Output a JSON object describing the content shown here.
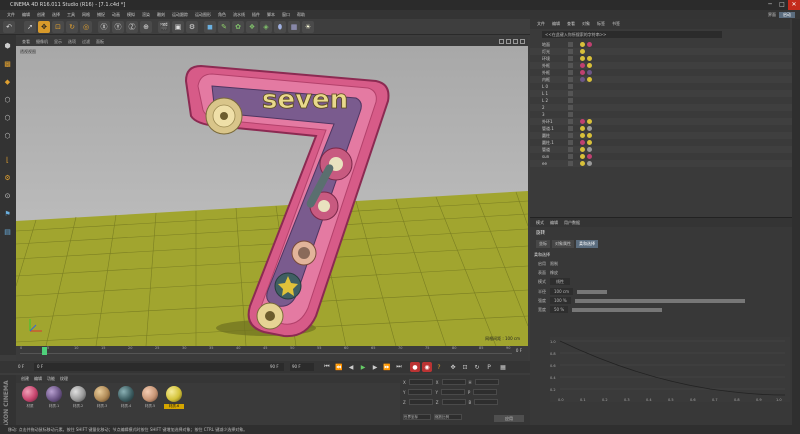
{
  "window": {
    "title": "CINEMA 4D R16.011 Studio (R16) - [7.1.c4d *]",
    "min": "─",
    "max": "□",
    "close": "✕"
  },
  "menu": [
    "文件",
    "编辑",
    "创建",
    "选择",
    "工具",
    "网格",
    "捕捉",
    "动画",
    "模拟",
    "渲染",
    "雕刻",
    "运动跟踪",
    "运动图形",
    "角色",
    "流水线",
    "插件",
    "脚本",
    "窗口",
    "帮助"
  ],
  "layout": {
    "label": "界面",
    "value": "启动"
  },
  "viewport": {
    "menu": [
      "查看",
      "摄像机",
      "显示",
      "选项",
      "过滤",
      "面板"
    ],
    "label": "透视视图",
    "grid_label": "网格间距 : 100 cm",
    "logo_text": "seven"
  },
  "timeline": {
    "ticks": [
      "0",
      "5",
      "10",
      "15",
      "20",
      "25",
      "30",
      "35",
      "40",
      "45",
      "50",
      "55",
      "60",
      "65",
      "70",
      "75",
      "80",
      "85",
      "90"
    ],
    "frame_end_label": "0 F",
    "current": "0 F",
    "start": "0 F",
    "end": "90 F",
    "end2": "90 F"
  },
  "materials": {
    "menu": [
      "创建",
      "编辑",
      "功能",
      "纹理"
    ],
    "items": [
      {
        "name": "材质",
        "color": "#c8466f"
      },
      {
        "name": "材质.1",
        "color": "#6c5687"
      },
      {
        "name": "材质.2",
        "color": "#9a9a9a"
      },
      {
        "name": "材质.3",
        "color": "#b08a57"
      },
      {
        "name": "材质.4",
        "color": "#3e5f63"
      },
      {
        "name": "材质.5",
        "color": "#c89676"
      },
      {
        "name": "材质.6",
        "color": "#d4c33a"
      }
    ]
  },
  "coords": {
    "rows": [
      {
        "a": "X",
        "v1": "0 cm",
        "b": "X",
        "v2": "0 cm",
        "c": "H",
        "v3": "0 °"
      },
      {
        "a": "Y",
        "v1": "0 cm",
        "b": "Y",
        "v2": "0 cm",
        "c": "P",
        "v3": "0 °"
      },
      {
        "a": "Z",
        "v1": "0 cm",
        "b": "Z",
        "v2": "0 cm",
        "c": "B",
        "v3": "0 °"
      }
    ],
    "mode1": "世界坐标",
    "mode2": "缩放比例",
    "apply": "应用"
  },
  "status": "移动: 点击并拖动鼠标移动元素。按住 SHIFT 键量化移动；节点编辑模式时按住 SHIFT 键增加选择对象；按住 CTRL 键减少选择对象。",
  "maxon": "MAXON CINEMA 4D",
  "objects": {
    "menu": [
      "文件",
      "编辑",
      "查看",
      "对象",
      "标签",
      "书签"
    ],
    "search": "<<在此键入你所搜索的字符串>>",
    "rows": [
      {
        "name": "地面",
        "tags": [
          "#d8c03a",
          "#c04070"
        ]
      },
      {
        "name": "灯光",
        "tags": [
          "#d8c03a"
        ]
      },
      {
        "name": "环境",
        "tags": [
          "#d8c03a",
          "#d8c03a"
        ]
      },
      {
        "name": "外框",
        "tags": [
          "#c04070",
          "#d8c03a"
        ]
      },
      {
        "name": "外框",
        "tags": [
          "#c04070",
          "#6c5687"
        ]
      },
      {
        "name": "内框",
        "tags": [
          "#6c5687",
          "#d8c03a"
        ]
      },
      {
        "name": "L 0",
        "tags": []
      },
      {
        "name": "L 1",
        "tags": []
      },
      {
        "name": "L 2",
        "tags": []
      },
      {
        "name": "2",
        "tags": []
      },
      {
        "name": "3",
        "tags": []
      },
      {
        "name": "外环1",
        "tags": [
          "#c04070",
          "#d8c03a"
        ]
      },
      {
        "name": "管道.1",
        "tags": [
          "#d8c03a",
          "#9a9a9a"
        ]
      },
      {
        "name": "圆柱",
        "tags": [
          "#d8c03a",
          "#d8c03a"
        ]
      },
      {
        "name": "圆柱.1",
        "tags": [
          "#c04070",
          "#d8c03a"
        ]
      },
      {
        "name": "管道",
        "tags": [
          "#d8c03a",
          "#9a9a9a"
        ]
      },
      {
        "name": "sun",
        "tags": [
          "#d8c03a",
          "#c04070"
        ]
      },
      {
        "name": "ee",
        "tags": [
          "#d8c03a",
          "#9a9a9a"
        ]
      }
    ]
  },
  "attributes": {
    "menu": [
      "模式",
      "编辑",
      "用户数据"
    ],
    "title": "旋转",
    "tabs": [
      "坐标",
      "对象属性",
      "柔和选择"
    ],
    "active_tab": "柔和选择",
    "section": "柔和选择",
    "rows": [
      {
        "label": "启用",
        "value": "限制"
      },
      {
        "label": "表面",
        "value": "橡皮"
      },
      {
        "label": "模式",
        "value": "线性"
      },
      {
        "label": "半径",
        "value": "100 cm"
      },
      {
        "label": "强度",
        "value": "100 %"
      },
      {
        "label": "宽度",
        "value": "50 %"
      }
    ],
    "curve_x": [
      "0.0",
      "0.1",
      "0.2",
      "0.3",
      "0.4",
      "0.5",
      "0.6",
      "0.7",
      "0.8",
      "0.9",
      "1.0"
    ],
    "curve_y": [
      "1.0",
      "0.8",
      "0.6",
      "0.4",
      "0.2"
    ]
  }
}
